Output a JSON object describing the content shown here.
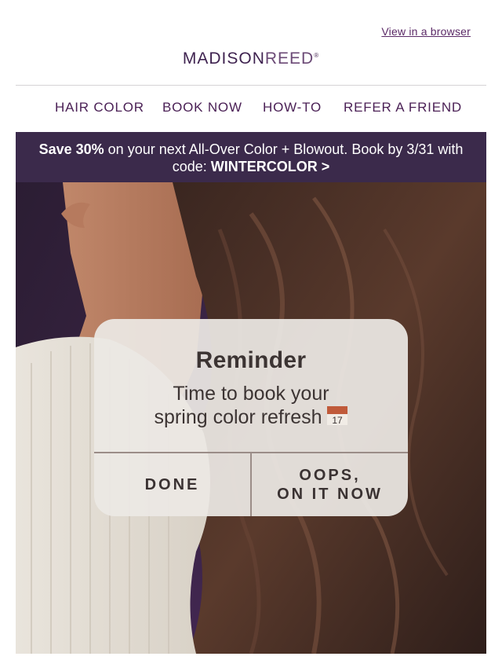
{
  "header": {
    "view_in_browser": "View in a browser",
    "logo_bold": "MADISON",
    "logo_light": "REED",
    "logo_mark": "®"
  },
  "nav": {
    "items": [
      {
        "label": "HAIR COLOR"
      },
      {
        "label": "BOOK NOW"
      },
      {
        "label": "HOW-TO"
      },
      {
        "label": "REFER A FRIEND"
      }
    ]
  },
  "promo": {
    "highlight": "Save 30%",
    "text": " on your next All-Over Color + Blowout. Book by 3/31 with code: ",
    "code": "WINTERCOLOR >"
  },
  "reminder": {
    "title": "Reminder",
    "line1": "Time to book your",
    "line2": "spring color refresh ",
    "calendar_icon": "calendar-icon",
    "calendar_day": "17",
    "done_label": "DONE",
    "oops_line1": "OOPS,",
    "oops_line2": "ON IT NOW"
  },
  "colors": {
    "brand_purple": "#4b2156",
    "promo_bg": "#3b2a4b",
    "divider": "#d6d3d6"
  }
}
